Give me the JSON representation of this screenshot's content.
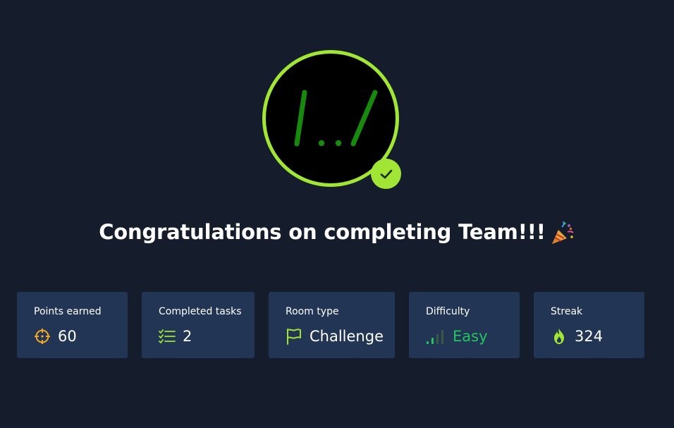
{
  "title": {
    "text": "Congratulations on completing Team!!!",
    "emoji": "party-popper-icon"
  },
  "badge": {
    "logo_text": "/../",
    "ring_color": "#a2e635",
    "logo_color": "#178a0e",
    "status": "completed"
  },
  "stats": {
    "points": {
      "label": "Points earned",
      "value": "60",
      "icon": "crosshair-icon"
    },
    "tasks": {
      "label": "Completed tasks",
      "value": "2",
      "icon": "checklist-icon"
    },
    "room_type": {
      "label": "Room type",
      "value": "Challenge",
      "icon": "flag-icon"
    },
    "difficulty": {
      "label": "Difficulty",
      "value": "Easy",
      "icon": "signal-bars-icon"
    },
    "streak": {
      "label": "Streak",
      "value": "324",
      "icon": "fire-icon"
    }
  },
  "colors": {
    "background": "#151c2b",
    "card": "#223554",
    "accent_green": "#a2e635",
    "easy_green": "#22c55e",
    "points_orange": "#f5a623"
  }
}
